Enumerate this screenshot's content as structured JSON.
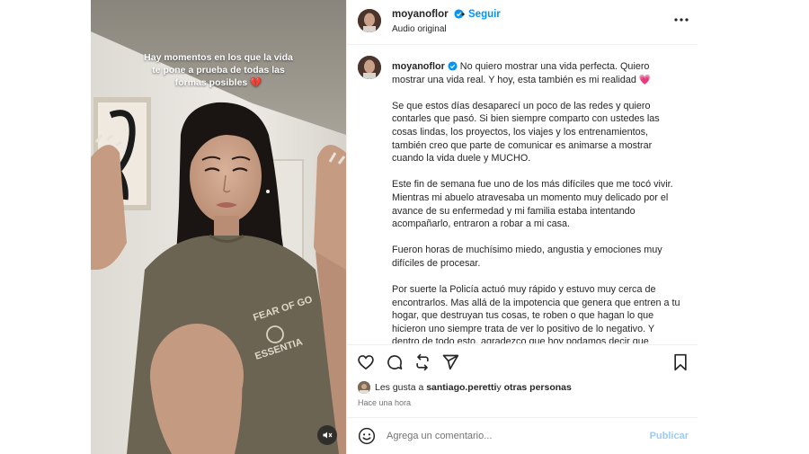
{
  "media": {
    "overlay_line1": "Hay momentos en los que la vida",
    "overlay_line2": "te pone a prueba de todas las",
    "overlay_line3": "formas posibles 💔",
    "shirt_text_top": "FEAR OF GO",
    "shirt_text_bottom": "ESSENTIA",
    "mute_icon": "speaker-muted-icon"
  },
  "header": {
    "username": "moyanoflor",
    "follow_label": "Seguir",
    "audio_label": "Audio original",
    "dot": "•"
  },
  "caption": {
    "username": "moyanoflor",
    "lead": " No quiero mostrar una vida perfecta. Quiero mostrar una vida real. Y hoy, esta también es mi realidad 💗",
    "p1": "Se que estos días desaparecí un poco de las redes y quiero contarles que pasó. Si bien siempre comparto con ustedes las cosas lindas, los proyectos, los viajes y los entrenamientos, también creo que parte de comunicar es animarse a mostrar cuando la vida duele y MUCHO.",
    "p2": "Este fin de semana fue uno de los más difíciles que me tocó vivir. Mientras mi abuelo atravesaba un momento muy delicado por el avance de su enfermedad y mi familia estaba intentando acompañarlo, entraron a robar a mi casa.",
    "p3": "Fueron horas de muchísimo miedo, angustia y emociones muy difíciles de procesar.",
    "p4": "Por suerte la Policía actuó muy rápido y estuvo muy cerca de encontrarlos. Mas allá de la impotencia que genera que entren a tu hogar, que destruyan tus cosas, te roben o que hagan lo que hicieron uno siempre trata de ver lo positivo de lo negativo. Y dentro de todo esto, agradezco que hoy podamos decir que estamos todos bien."
  },
  "likes": {
    "prefix": "Les gusta a ",
    "user": "santiago.peretti",
    "middle": " y ",
    "others": "otras personas"
  },
  "time": "Hace una hora",
  "comment": {
    "placeholder": "Agrega un comentario...",
    "post_label": "Publicar"
  },
  "colors": {
    "accent": "#0095f6",
    "post_disabled": "#9ccbf5",
    "text": "#262626",
    "muted": "#737373"
  }
}
